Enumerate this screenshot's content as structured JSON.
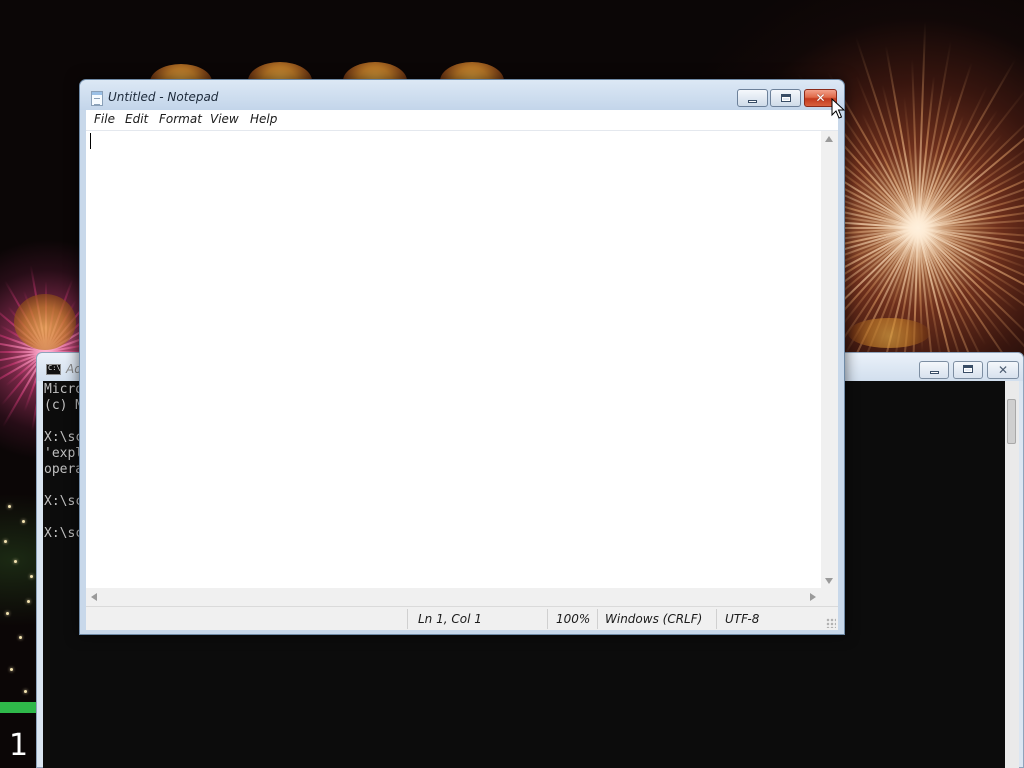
{
  "desktop": {
    "workspace_number": "1"
  },
  "console_window": {
    "title": "Ad",
    "lines": [
      "Micro",
      "(c) M",
      "",
      "X:\\sc",
      "'expl",
      "opera",
      "",
      "X:\\sc",
      "",
      "X:\\sc"
    ]
  },
  "notepad": {
    "title": "Untitled - Notepad",
    "menu": {
      "file": "File",
      "edit": "Edit",
      "format": "Format",
      "view": "View",
      "help": "Help"
    },
    "document_text": "",
    "status": {
      "position": "Ln 1, Col 1",
      "zoom": "100%",
      "line_ending": "Windows (CRLF)",
      "encoding": "UTF-8"
    },
    "buttons": {
      "close_glyph": "✕"
    }
  },
  "colors": {
    "close_button": "#d8603e",
    "title_bar": "#c3d5ea",
    "console_background": "#0c0c0c",
    "taskbar_green": "#2fb84a"
  },
  "icons": [
    "notepad-icon",
    "console-icon",
    "minimize-icon",
    "maximize-icon",
    "close-icon",
    "mouse-cursor-icon"
  ]
}
